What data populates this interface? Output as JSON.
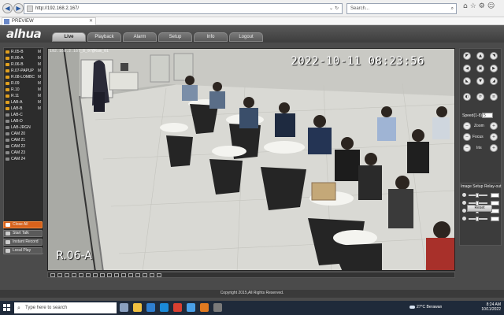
{
  "browser": {
    "address": "http://192.168.2.167/",
    "search_placeholder": "Search...",
    "tab_title": "PREVIEW"
  },
  "app": {
    "logo": "alhua",
    "menu": [
      {
        "label": "Live",
        "active": true
      },
      {
        "label": "Playback",
        "active": false
      },
      {
        "label": "Alarm",
        "active": false
      },
      {
        "label": "Setup",
        "active": false
      },
      {
        "label": "Info",
        "active": false
      },
      {
        "label": "Logout",
        "active": false
      }
    ]
  },
  "sidebar": {
    "channels": [
      {
        "label": "R.05-B",
        "flag": "M",
        "active": true
      },
      {
        "label": "R.06-A",
        "flag": "M",
        "active": true
      },
      {
        "label": "R.06-B",
        "flag": "M",
        "active": true
      },
      {
        "label": "R.07-PAPUP",
        "flag": "M",
        "active": true
      },
      {
        "label": "R.08-LOMBC",
        "flag": "M",
        "active": true
      },
      {
        "label": "R.09",
        "flag": "M",
        "active": true
      },
      {
        "label": "R.10",
        "flag": "M",
        "active": true
      },
      {
        "label": "R.11",
        "flag": "M",
        "active": true
      },
      {
        "label": "LAB-A",
        "flag": "M",
        "active": true
      },
      {
        "label": "LAB-B",
        "flag": "M",
        "active": true
      },
      {
        "label": "LAB-C",
        "flag": "",
        "active": false
      },
      {
        "label": "LAB-D",
        "flag": "",
        "active": false
      },
      {
        "label": "LAB-JRGN",
        "flag": "",
        "active": false
      },
      {
        "label": "CAM 20",
        "flag": "",
        "active": false
      },
      {
        "label": "CAM 21",
        "flag": "",
        "active": false
      },
      {
        "label": "CAM 22",
        "flag": "",
        "active": false
      },
      {
        "label": "CAM 23",
        "flag": "",
        "active": false
      },
      {
        "label": "CAM 24",
        "flag": "",
        "active": false
      }
    ],
    "buttons": {
      "close_all": "Close All",
      "start_talk": "Start Talk",
      "instant_record": "Instant Record",
      "local_play": "Local Play"
    }
  },
  "video": {
    "osd_top": "192.168.2.167_8_97@Ram_01",
    "timestamp": "2022-10-11  08:23:56",
    "camera_label": "R.06-A"
  },
  "ptz": {
    "speed_label": "Speed(1-8)",
    "speed_value": "5",
    "zoom_label": "Zoom",
    "focus_label": "Focus",
    "iris_label": "Iris"
  },
  "image_setup": {
    "tab1": "Image Setup",
    "tab2": "Relay-out",
    "reset": "Reset"
  },
  "footer": {
    "copyright": "Copyright 2015,All Rights Reserved."
  },
  "taskbar": {
    "search": "Type here to search",
    "weather": "27°C  Berawan",
    "time": "8:24 AM",
    "date": "10/11/2022"
  }
}
